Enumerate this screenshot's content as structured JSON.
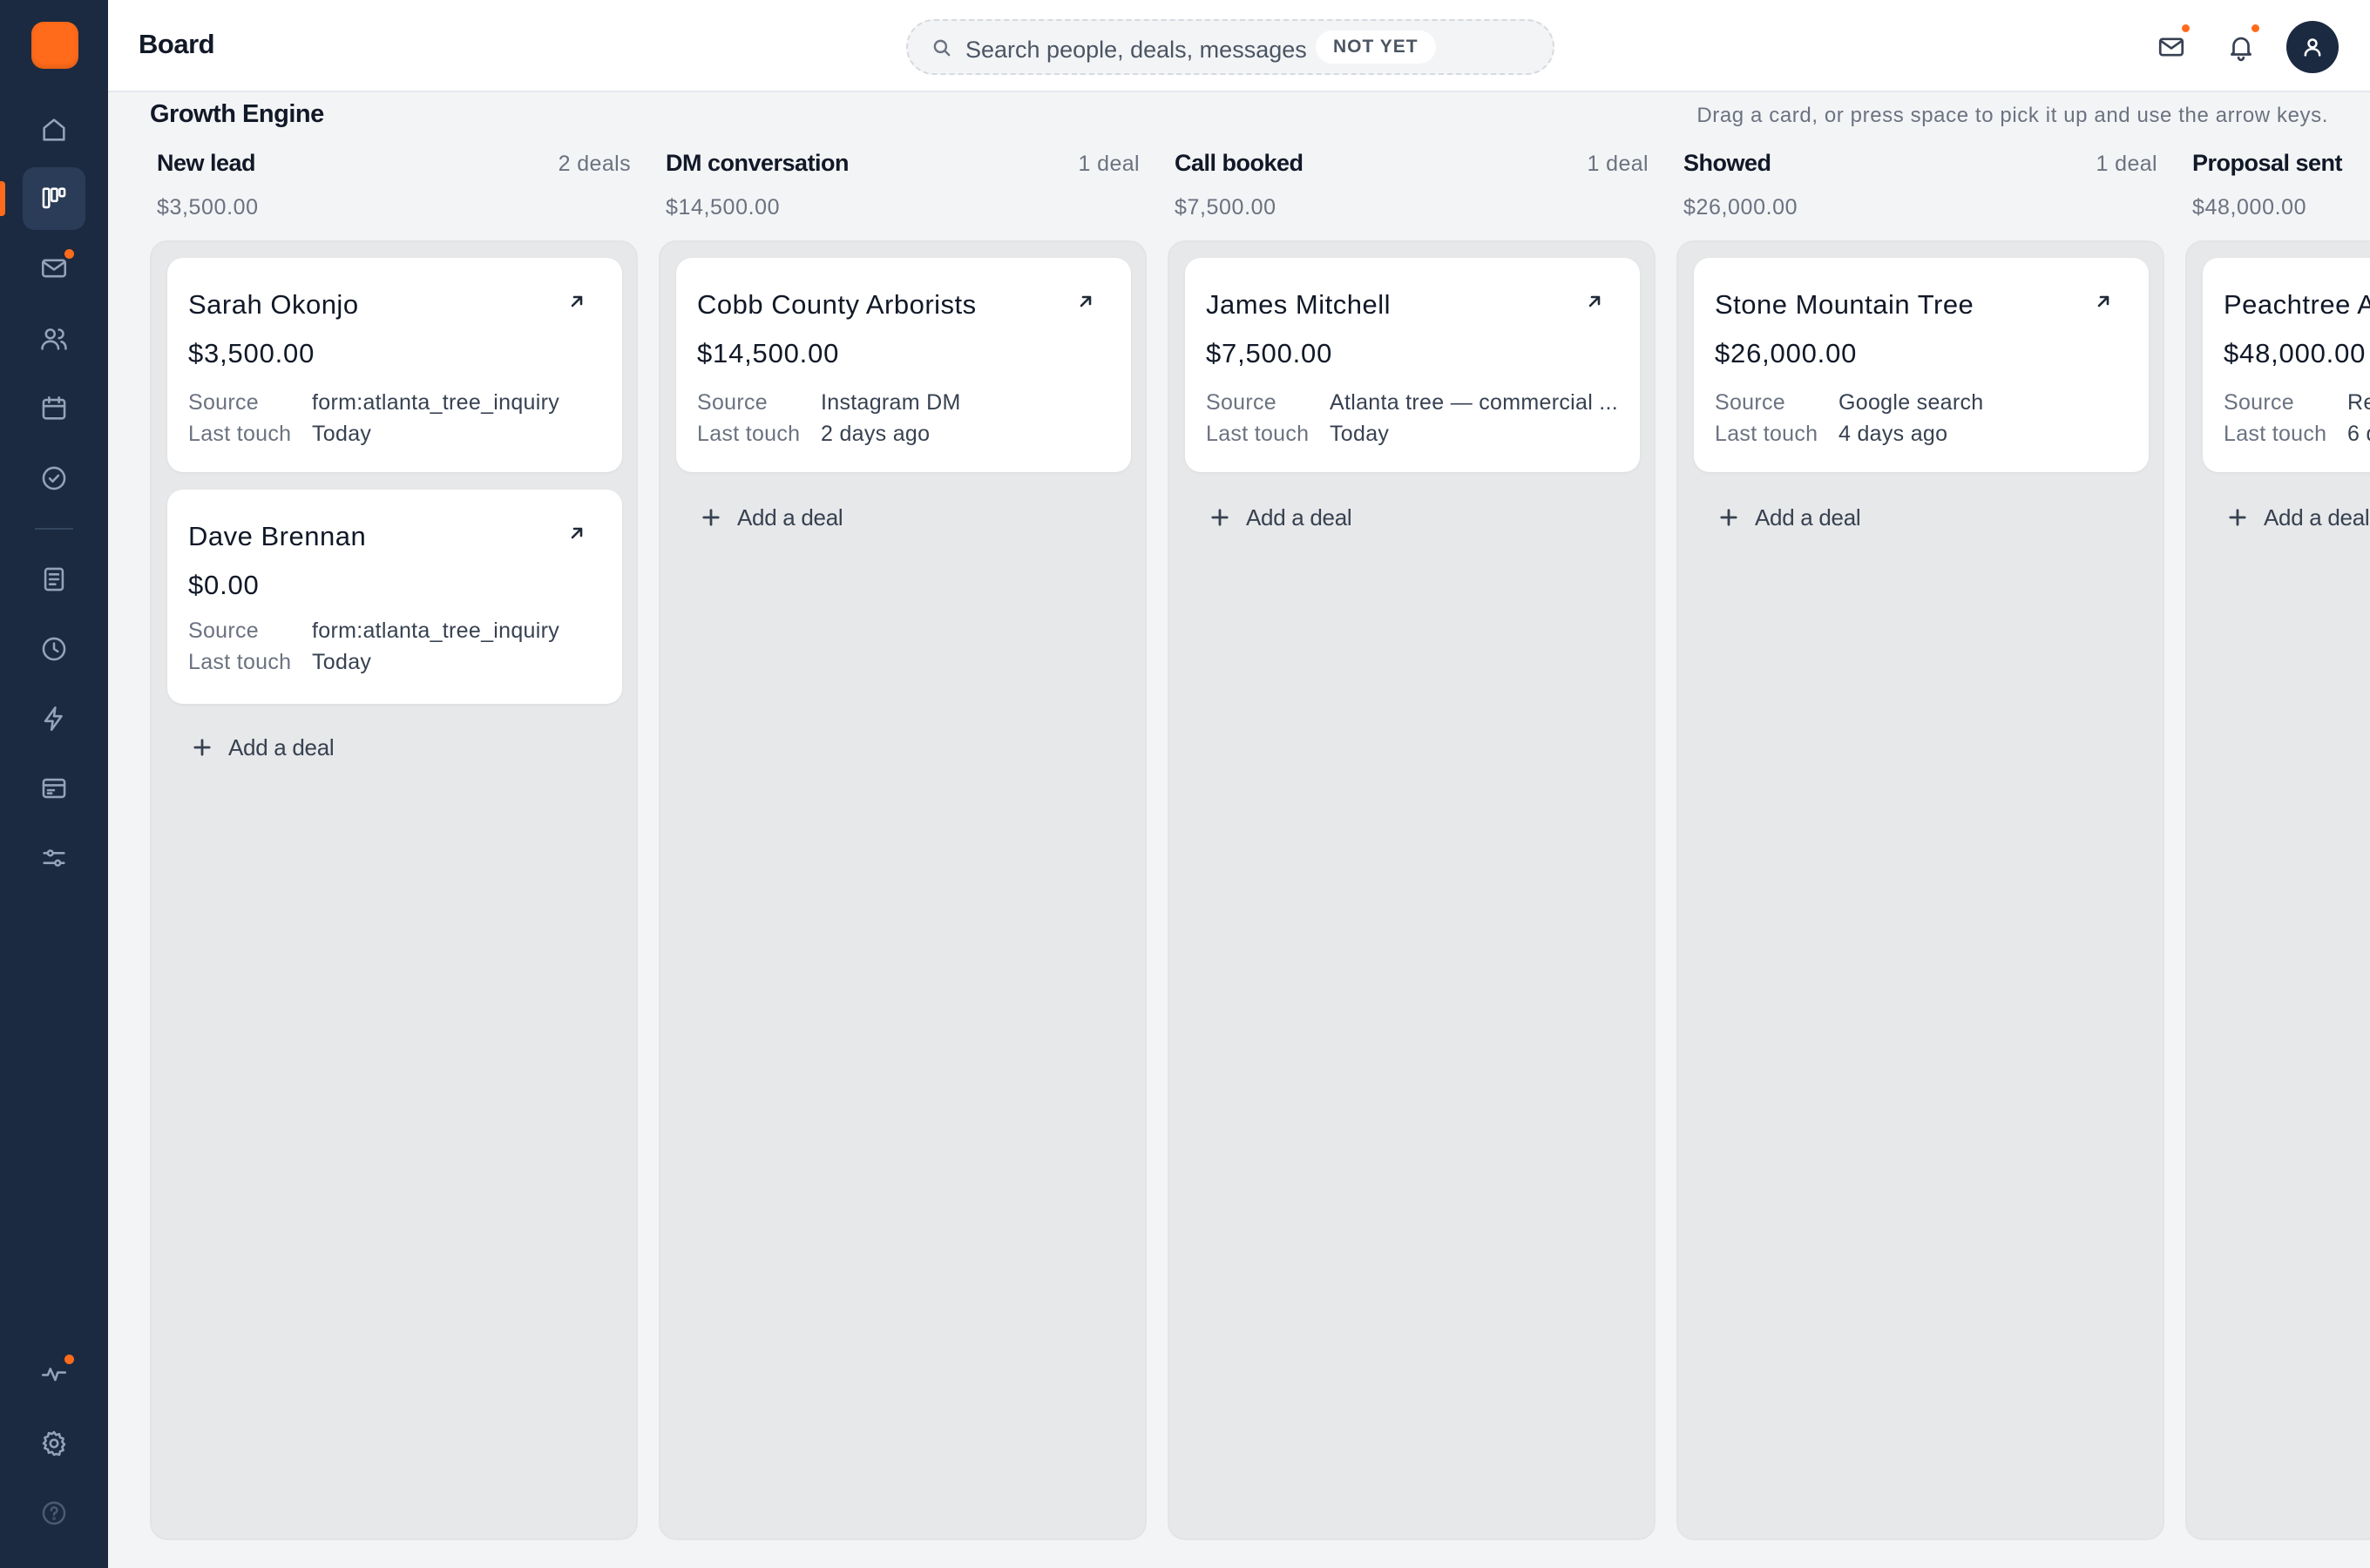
{
  "header": {
    "page_title": "Board",
    "search_placeholder": "Search people, deals, messages",
    "search_badge": "NOT YET"
  },
  "sidebar": {
    "items": [
      {
        "name": "home",
        "icon": "home-icon"
      },
      {
        "name": "board",
        "icon": "kanban-icon",
        "active": true
      },
      {
        "name": "inbox",
        "icon": "mail-icon",
        "notification": true
      },
      {
        "name": "contacts",
        "icon": "users-icon"
      },
      {
        "name": "calendar",
        "icon": "calendar-icon"
      },
      {
        "name": "tasks",
        "icon": "check-circle-icon"
      },
      {
        "name": "documents",
        "icon": "document-icon"
      },
      {
        "name": "history",
        "icon": "clock-icon"
      },
      {
        "name": "automations",
        "icon": "lightning-icon"
      },
      {
        "name": "billing",
        "icon": "invoice-icon"
      },
      {
        "name": "filters",
        "icon": "sliders-icon"
      },
      {
        "name": "activity",
        "icon": "pulse-icon",
        "notification": true
      },
      {
        "name": "settings",
        "icon": "gear-icon"
      },
      {
        "name": "help",
        "icon": "help-icon"
      }
    ]
  },
  "board": {
    "name": "Growth Engine",
    "hint": "Drag a card, or press space to pick it up and use the arrow keys."
  },
  "columns": [
    {
      "title": "New lead",
      "count": "2 deals",
      "total": "$3,500.00",
      "cards": [
        {
          "name": "Sarah Okonjo",
          "amount": "$3,500.00",
          "source_label": "Source",
          "source": "form:atlanta_tree_inquiry",
          "touch_label": "Last touch",
          "last_touch": "Today"
        },
        {
          "name": "Dave Brennan",
          "amount": "$0.00",
          "source_label": "Source",
          "source": "form:atlanta_tree_inquiry",
          "touch_label": "Last touch",
          "last_touch": "Today"
        }
      ],
      "add_label": "Add a deal"
    },
    {
      "title": "DM conversation",
      "count": "1 deal",
      "total": "$14,500.00",
      "cards": [
        {
          "name": "Cobb County Arborists",
          "amount": "$14,500.00",
          "source_label": "Source",
          "source": "Instagram DM",
          "touch_label": "Last touch",
          "last_touch": "2 days ago"
        }
      ],
      "add_label": "Add a deal"
    },
    {
      "title": "Call booked",
      "count": "1 deal",
      "total": "$7,500.00",
      "cards": [
        {
          "name": "James Mitchell",
          "amount": "$7,500.00",
          "source_label": "Source",
          "source": "Atlanta tree — commercial ...",
          "touch_label": "Last touch",
          "last_touch": "Today"
        }
      ],
      "add_label": "Add a deal"
    },
    {
      "title": "Showed",
      "count": "1 deal",
      "total": "$26,000.00",
      "cards": [
        {
          "name": "Stone Mountain Tree",
          "amount": "$26,000.00",
          "source_label": "Source",
          "source": "Google search",
          "touch_label": "Last touch",
          "last_touch": "4 days ago"
        }
      ],
      "add_label": "Add a deal"
    },
    {
      "title": "Proposal sent",
      "count": "",
      "total": "$48,000.00",
      "cards": [
        {
          "name": "Peachtree A",
          "amount": "$48,000.00",
          "source_label": "Source",
          "source": "Re",
          "touch_label": "Last touch",
          "last_touch": "6 d"
        }
      ],
      "add_label": "Add a deal"
    }
  ],
  "colors": {
    "accent": "#ff6b1a",
    "sidebar": "#1b2a41",
    "lane": "#e7e8e9",
    "background": "#f3f4f6"
  }
}
